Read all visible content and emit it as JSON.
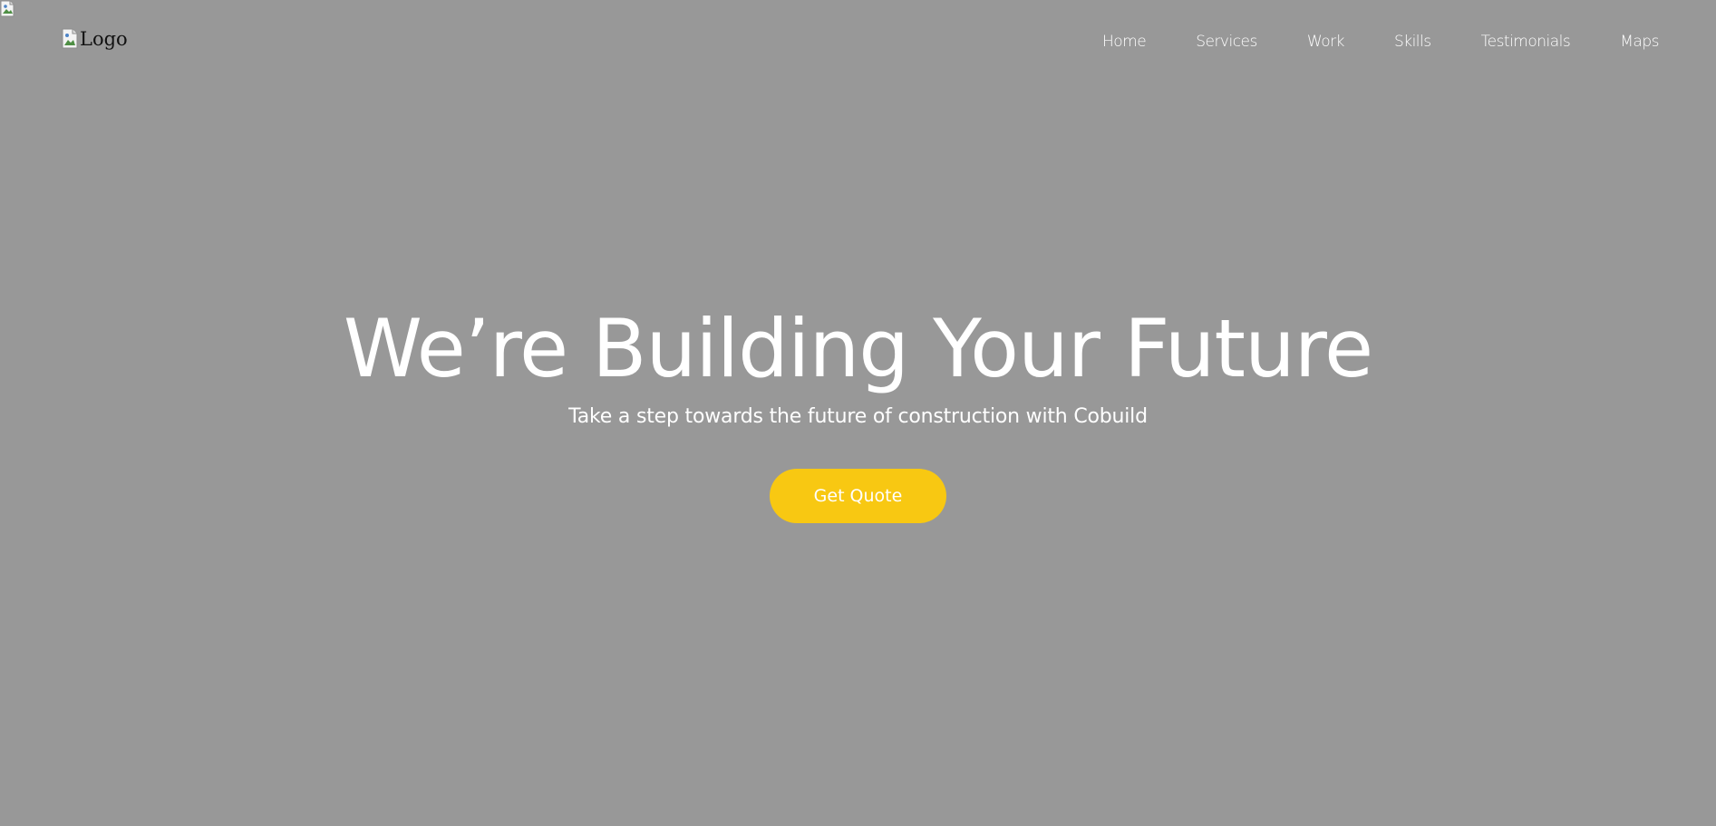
{
  "header": {
    "logo_alt": "Logo",
    "nav": [
      {
        "label": "Home"
      },
      {
        "label": "Services"
      },
      {
        "label": "Work"
      },
      {
        "label": "Skills"
      },
      {
        "label": "Testimonials"
      },
      {
        "label": "Maps"
      }
    ]
  },
  "hero": {
    "title": "We’re Building Your Future",
    "subtitle": "Take a step towards the future of construction with Cobuild",
    "cta_label": "Get Quote"
  },
  "colors": {
    "background": "#989898",
    "accent": "#f8c812",
    "text": "#ffffff"
  },
  "icons": {
    "background_image": "broken-image-icon",
    "logo_image": "broken-image-icon"
  }
}
